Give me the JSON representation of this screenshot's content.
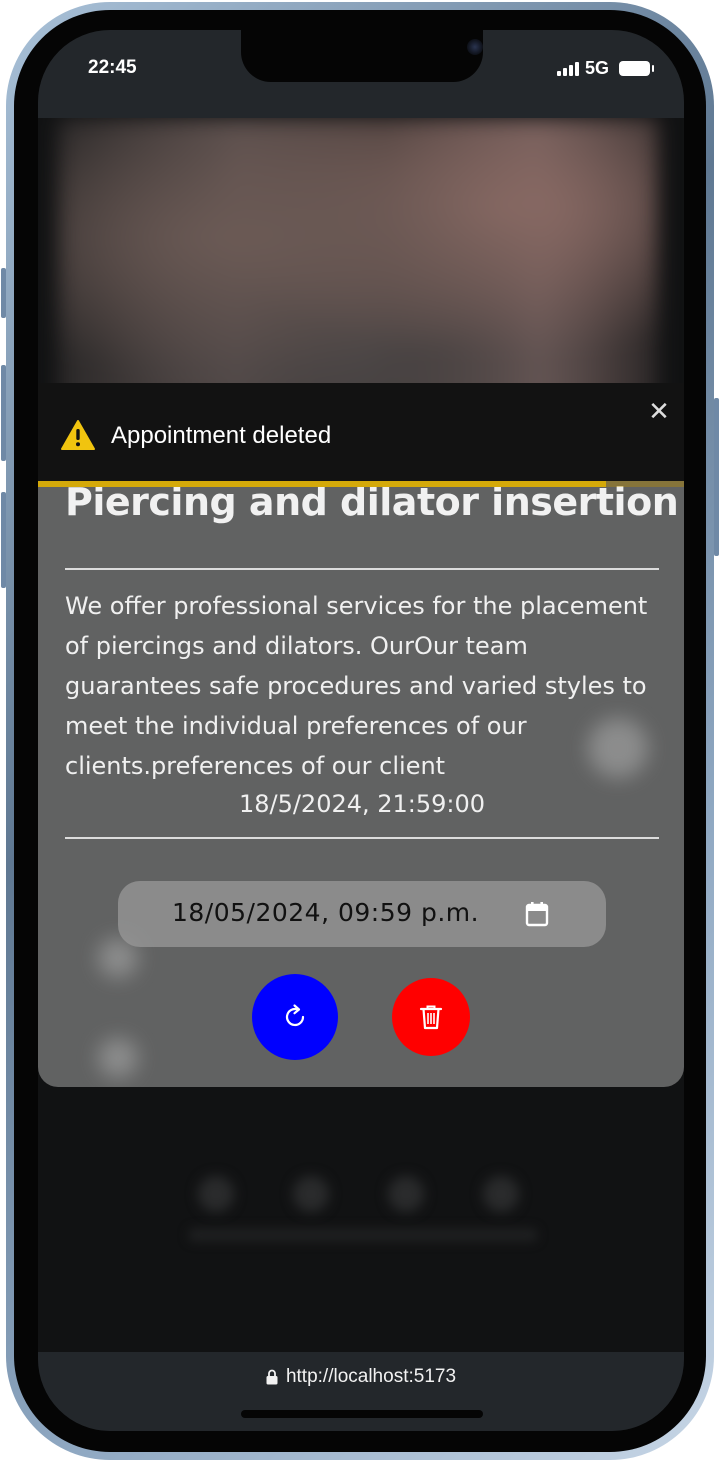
{
  "status_bar": {
    "time": "22:45",
    "network": "5G"
  },
  "toast": {
    "message": "Appointment deleted",
    "close_symbol": "✕",
    "icon": "warning-icon",
    "progress_fraction": 0.88,
    "accent_color": "#d4a90a"
  },
  "service_card": {
    "title": "Piercing and dilator insertion",
    "description": "We offer professional services for the placement of piercings and dilators. OurOur team guarantees safe procedures and varied styles to meet the individual preferences of our clients.preferences of our client",
    "datetime": "18/5/2024, 21:59:00",
    "datetime_input_value": "18/05/2024, 09:59 p.m.",
    "update_button": {
      "icon": "refresh-icon",
      "color": "#0000ff"
    },
    "delete_button": {
      "icon": "trash-icon",
      "color": "#ff0000"
    }
  },
  "browser": {
    "url": "http://localhost:5173"
  }
}
